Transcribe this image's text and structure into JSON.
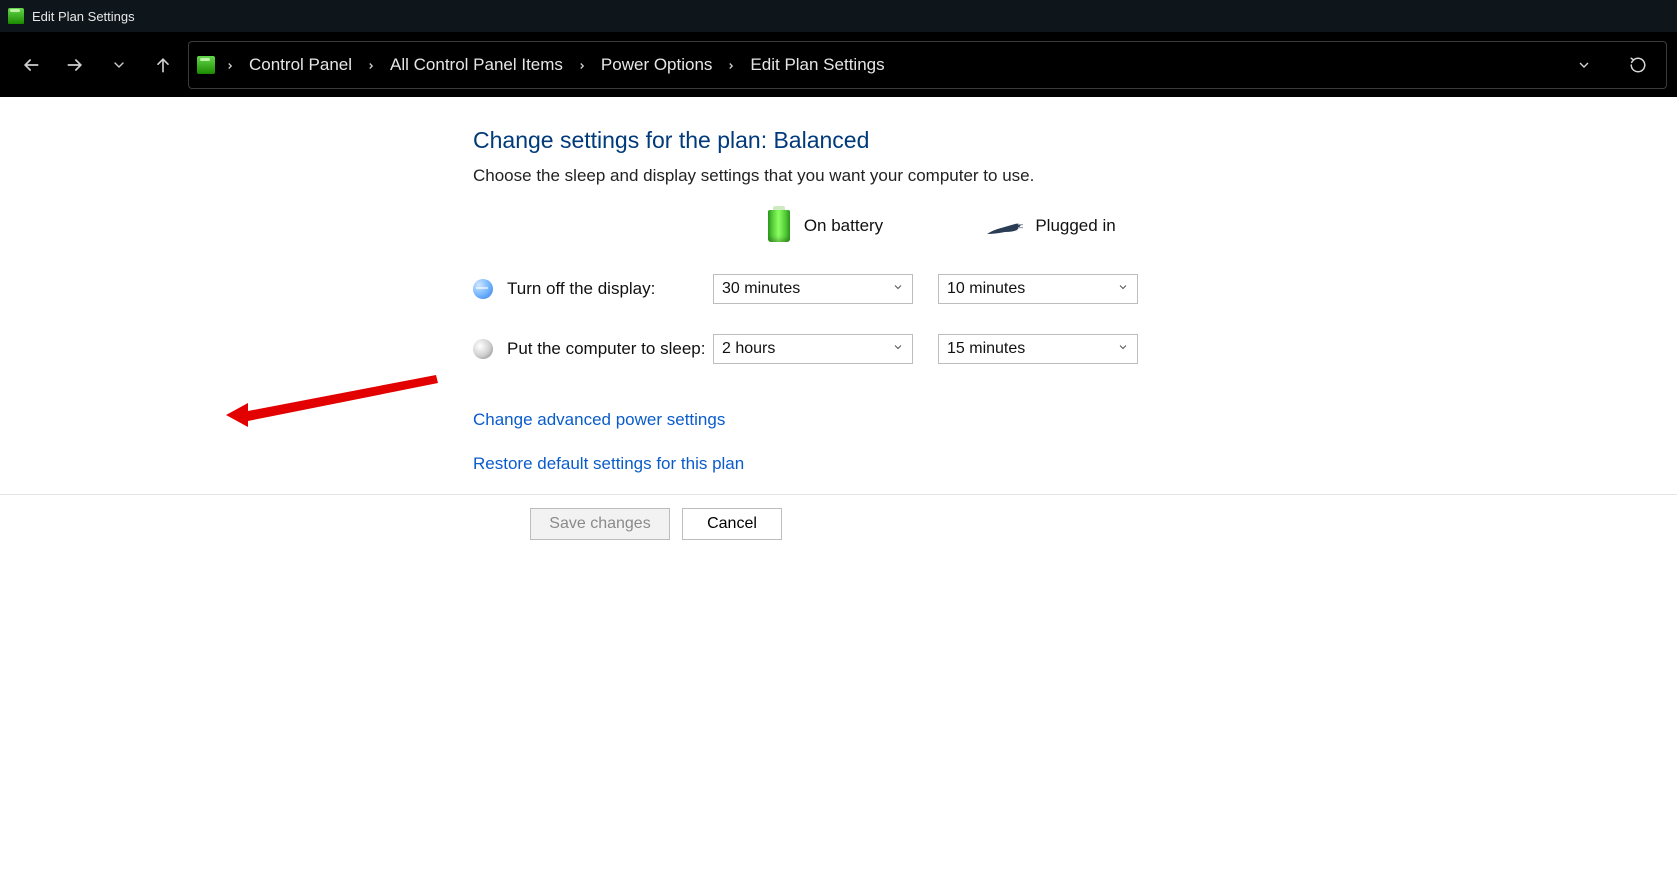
{
  "window_title": "Edit Plan Settings",
  "breadcrumb": {
    "items": [
      "Control Panel",
      "All Control Panel Items",
      "Power Options",
      "Edit Plan Settings"
    ]
  },
  "page": {
    "heading": "Change settings for the plan: Balanced",
    "subtext": "Choose the sleep and display settings that you want your computer to use.",
    "columns": {
      "battery": "On battery",
      "plugged": "Plugged in"
    },
    "rows": {
      "display": {
        "label": "Turn off the display:",
        "battery_value": "30 minutes",
        "plugged_value": "10 minutes"
      },
      "sleep": {
        "label": "Put the computer to sleep:",
        "battery_value": "2 hours",
        "plugged_value": "15 minutes"
      }
    },
    "links": {
      "advanced": "Change advanced power settings",
      "restore": "Restore default settings for this plan"
    },
    "buttons": {
      "save": "Save changes",
      "cancel": "Cancel"
    }
  }
}
